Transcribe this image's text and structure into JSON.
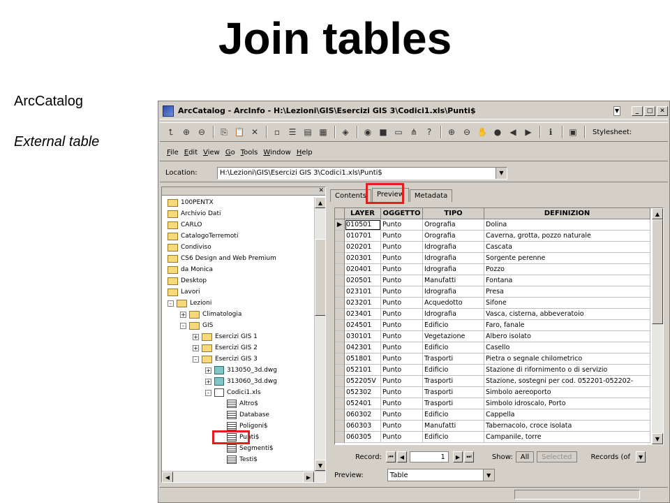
{
  "slide": {
    "title": "Join tables",
    "side_text_1": "ArcCatalog",
    "side_text_2": "External table"
  },
  "window": {
    "title": "ArcCatalog - ArcInfo - H:\\Lezioni\\GIS\\Esercizi GIS 3\\Codici1.xls\\Punti$",
    "stylesheet_label": "Stylesheet:"
  },
  "menu": [
    "File",
    "Edit",
    "View",
    "Go",
    "Tools",
    "Window",
    "Help"
  ],
  "location": {
    "label": "Location:",
    "value": "H:\\Lezioni\\GIS\\Esercizi GIS 3\\Codici1.xls\\Punti$"
  },
  "tree": [
    {
      "label": "100PENTX",
      "type": "folder"
    },
    {
      "label": "Archivio Dati",
      "type": "folder"
    },
    {
      "label": "CARLO",
      "type": "folder"
    },
    {
      "label": "CatalogoTerremoti",
      "type": "folder"
    },
    {
      "label": "Condiviso",
      "type": "folder"
    },
    {
      "label": "CS6 Design and Web Premium",
      "type": "folder"
    },
    {
      "label": "da Monica",
      "type": "folder"
    },
    {
      "label": "Desktop",
      "type": "folder"
    },
    {
      "label": "Lavori",
      "type": "folder"
    },
    {
      "label": "Lezioni",
      "type": "folder"
    },
    {
      "label": "Climatologia",
      "type": "folder"
    },
    {
      "label": "GIS",
      "type": "folder"
    },
    {
      "label": "Esercizi GIS 1",
      "type": "folder"
    },
    {
      "label": "Esercizi GIS 2",
      "type": "folder"
    },
    {
      "label": "Esercizi GIS 3",
      "type": "folder"
    },
    {
      "label": "313050_3d.dwg",
      "type": "dwg"
    },
    {
      "label": "313060_3d.dwg",
      "type": "dwg"
    },
    {
      "label": "Codici1.xls",
      "type": "xls"
    },
    {
      "label": "Altro$",
      "type": "table"
    },
    {
      "label": "Database",
      "type": "table"
    },
    {
      "label": "Poligoni$",
      "type": "table"
    },
    {
      "label": "Punti$",
      "type": "table"
    },
    {
      "label": "Segmenti$",
      "type": "table"
    },
    {
      "label": "Testi$",
      "type": "table"
    }
  ],
  "tabs": [
    "Contents",
    "Preview",
    "Metadata"
  ],
  "grid": {
    "headers": [
      "LAYER",
      "OGGETTO",
      "TIPO",
      "DEFINIZION"
    ],
    "rows": [
      [
        "010501",
        "Punto",
        "Orografia",
        "Dolina"
      ],
      [
        "010701",
        "Punto",
        "Orografia",
        "Caverna, grotta, pozzo naturale"
      ],
      [
        "020201",
        "Punto",
        "Idrografia",
        "Cascata"
      ],
      [
        "020301",
        "Punto",
        "Idrografia",
        "Sorgente perenne"
      ],
      [
        "020401",
        "Punto",
        "Idrografia",
        "Pozzo"
      ],
      [
        "020501",
        "Punto",
        "Manufatti",
        "Fontana"
      ],
      [
        "023101",
        "Punto",
        "Idrografia",
        "Presa"
      ],
      [
        "023201",
        "Punto",
        "Acquedotto",
        "Sifone"
      ],
      [
        "023401",
        "Punto",
        "Idrografia",
        "Vasca, cisterna, abbeveratoio"
      ],
      [
        "024501",
        "Punto",
        "Edificio",
        "Faro, fanale"
      ],
      [
        "030101",
        "Punto",
        "Vegetazione",
        "Albero isolato"
      ],
      [
        "042301",
        "Punto",
        "Edificio",
        "Casello"
      ],
      [
        "051801",
        "Punto",
        "Trasporti",
        "Pietra o segnale chilometrico"
      ],
      [
        "052101",
        "Punto",
        "Edificio",
        "Stazione di rifornimento o di servizio"
      ],
      [
        "052205V",
        "Punto",
        "Trasporti",
        "Stazione, sostegni per cod. 052201-052202-"
      ],
      [
        "052302",
        "Punto",
        "Trasporti",
        "Simbolo aereoporto"
      ],
      [
        "052401",
        "Punto",
        "Trasporti",
        "Simbolo idroscalo, Porto"
      ],
      [
        "060302",
        "Punto",
        "Edificio",
        "Cappella"
      ],
      [
        "060303",
        "Punto",
        "Manufatti",
        "Tabernacolo, croce isolata"
      ],
      [
        "060305",
        "Punto",
        "Edificio",
        "Campanile, torre"
      ]
    ]
  },
  "records": {
    "label": "Record:",
    "value": "1",
    "show_label": "Show:",
    "all": "All",
    "selected": "Selected",
    "records_of": "Records (of"
  },
  "preview": {
    "label": "Preview:",
    "value": "Table"
  }
}
